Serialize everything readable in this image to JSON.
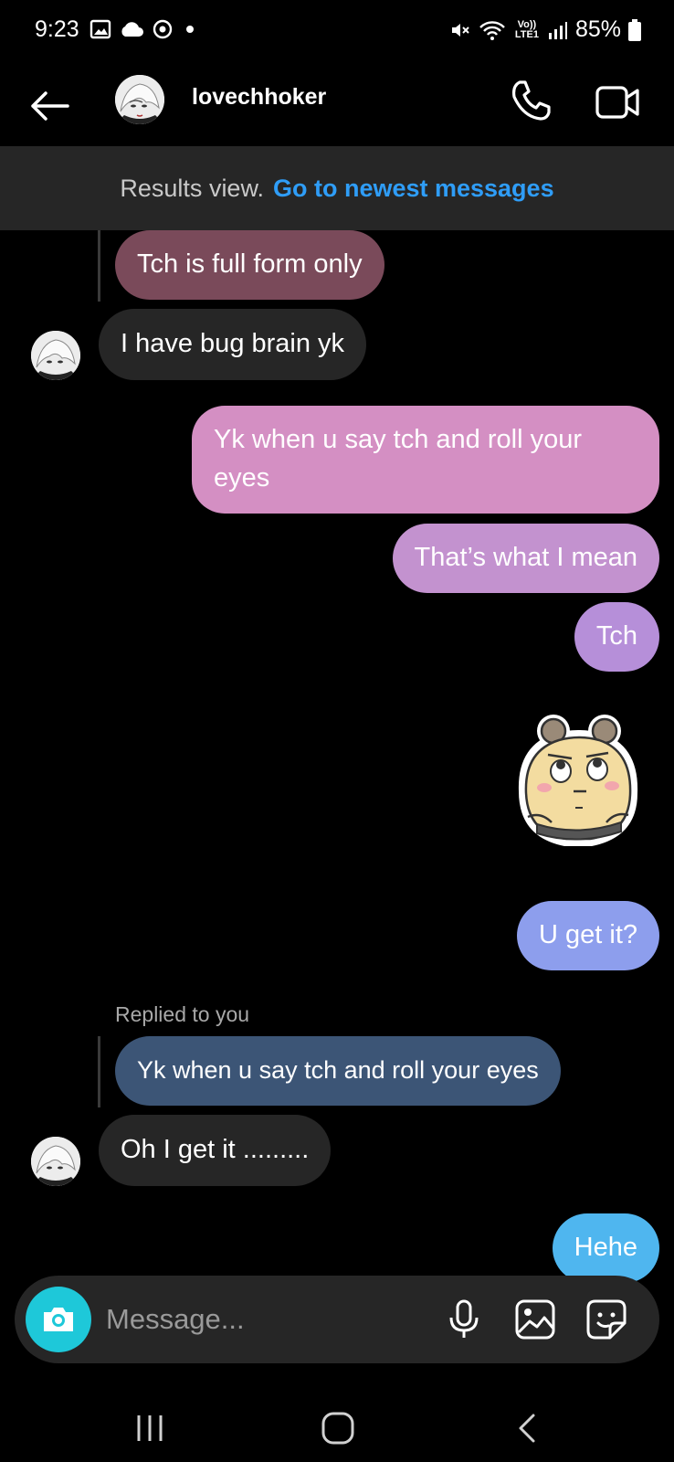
{
  "status_bar": {
    "time": "9:23",
    "volte": "Vo)) LTE1",
    "battery": "85%"
  },
  "header": {
    "contact_name": "lovechhoker"
  },
  "banner": {
    "results_text": "Results view.",
    "goto_link": "Go to newest messages"
  },
  "messages": [
    {
      "sender": "them",
      "type": "reply-quote",
      "text": "Tch is full form only"
    },
    {
      "sender": "them",
      "text": "I have bug brain yk"
    },
    {
      "sender": "me",
      "text": "Yk when u say tch and roll your eyes"
    },
    {
      "sender": "me",
      "text": "That’s what I mean"
    },
    {
      "sender": "me",
      "text": "Tch"
    },
    {
      "sender": "me",
      "type": "sticker"
    },
    {
      "sender": "me",
      "text": "U get it?"
    },
    {
      "sender": "them",
      "type": "reply-label",
      "text": "Replied to you"
    },
    {
      "sender": "them",
      "type": "reply-quote",
      "text": "Yk when u say tch and roll your eyes"
    },
    {
      "sender": "them",
      "text": "Oh I get it ........."
    },
    {
      "sender": "me",
      "text": "Hehe"
    }
  ],
  "composer": {
    "placeholder": "Message..."
  },
  "colors": {
    "bubble_pink": "#d48fc3",
    "bubble_purple": "#b78fda",
    "bubble_blue": "#8d9eed",
    "bubble_cyan": "#4fb6ef",
    "bubble_them": "#262626",
    "quote_mauve": "#7a4a5a",
    "quote_slate": "#3c5576",
    "accent_link": "#2f9df7",
    "camera": "#1ec8d9"
  }
}
